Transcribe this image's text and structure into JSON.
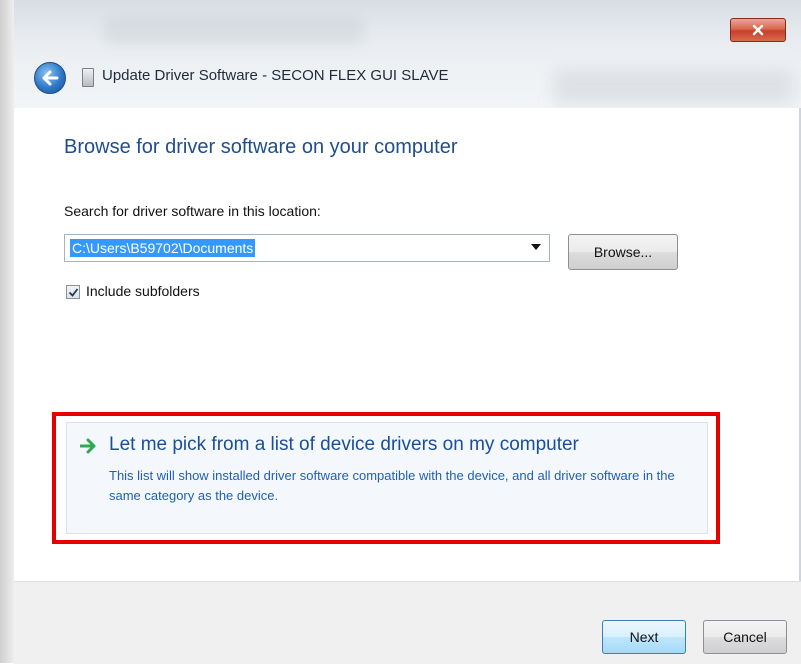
{
  "window": {
    "title": "Update Driver Software - SECON FLEX GUI SLAVE",
    "close_label": "X"
  },
  "main": {
    "heading": "Browse for driver software on your computer",
    "search_label": "Search for driver software in this location:",
    "path_value": "C:\\Users\\B59702\\Documents",
    "browse_label": "Browse...",
    "include_subfolders_label": "Include subfolders",
    "include_subfolders_checked": true
  },
  "pick_option": {
    "title": "Let me pick from a list of device drivers on my computer",
    "description": "This list will show installed driver software compatible with the device, and all driver software in the same category as the device."
  },
  "footer": {
    "next_label": "Next",
    "cancel_label": "Cancel"
  },
  "colors": {
    "heading_blue": "#1f4e8c",
    "link_blue": "#1a4e99",
    "highlight_red": "#e60000",
    "selection_blue": "#3399ff",
    "arrow_green": "#2fa84f"
  },
  "icons": {
    "back": "back-arrow-icon",
    "device": "device-icon",
    "close": "close-icon",
    "pick_arrow": "green-arrow-icon",
    "checkbox": "checkmark-icon",
    "dropdown": "chevron-down-icon"
  }
}
